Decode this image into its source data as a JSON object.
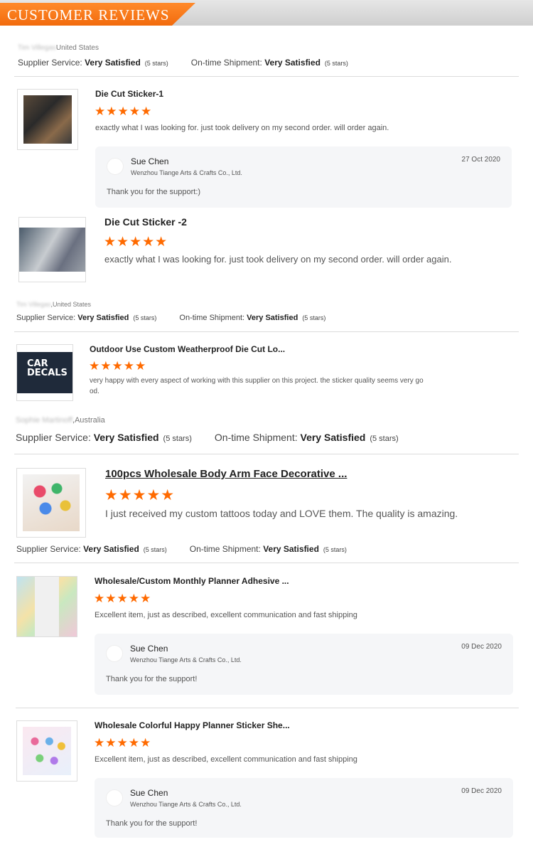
{
  "header": {
    "title": "CUSTOMER REVIEWS"
  },
  "labels": {
    "supplier_service": "Supplier Service:",
    "ontime_shipment": "On-time Shipment:",
    "very_satisfied": "Very Satisfied",
    "five_stars": "(5 stars)",
    "star_glyphs": "★★★★★"
  },
  "buyers": [
    {
      "name": "Tim Villegas",
      "country": "United States"
    },
    {
      "name": "Tim Villegas",
      "country": ",United States"
    },
    {
      "name": "Sophie Martinoff",
      "country": ",Australia"
    },
    {
      "name": "",
      "country": ""
    }
  ],
  "reviews": [
    {
      "title": "Die Cut Sticker-1",
      "stars": 5,
      "text": "exactly what I was looking for. just took delivery on my second order.   will order again."
    },
    {
      "title": "Die Cut Sticker -2",
      "stars": 5,
      "text": "exactly what I was looking for. just took delivery on my second order.   will order again."
    },
    {
      "title": "Outdoor Use Custom Weatherproof Die Cut Lo...",
      "stars": 5,
      "text_line1": "very happy with every aspect of working with this supplier on this project.  the sticker quality seems very go",
      "text_line2": "od."
    },
    {
      "title": "100pcs Wholesale Body Arm Face Decorative ...",
      "stars": 5,
      "text": "I just received my custom tattoos today and LOVE them. The quality is amazing."
    },
    {
      "title": "Wholesale/Custom Monthly Planner Adhesive ...",
      "stars": 5,
      "text": "Excellent item, just as described, excellent communication and fast shipping"
    },
    {
      "title": "Wholesale Colorful Happy Planner Sticker She...",
      "stars": 5,
      "text": "Excellent item, just as described, excellent communication and fast shipping"
    }
  ],
  "replies": [
    {
      "name": "Sue Chen",
      "company": "Wenzhou Tiange Arts & Crafts Co., Ltd.",
      "date": "27 Oct 2020",
      "message": "Thank you for the support:)"
    },
    {
      "name": "Sue Chen",
      "company": "Wenzhou Tiange Arts & Crafts Co., Ltd.",
      "date": "09 Dec 2020",
      "message": "Thank you for the support!"
    },
    {
      "name": "Sue Chen",
      "company": "Wenzhou Tiange Arts & Crafts Co., Ltd.",
      "date": "09 Dec 2020",
      "message": "Thank you for the support!"
    }
  ],
  "thumb_text": {
    "car": "CAR",
    "decals": "DECALS"
  },
  "colors": {
    "accent": "#f26b0d",
    "star": "#ff6a00"
  }
}
